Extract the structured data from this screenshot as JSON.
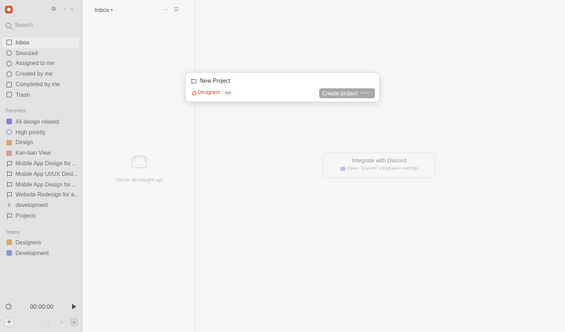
{
  "sidebar": {
    "search_placeholder": "Search",
    "nav": [
      {
        "label": "Inbox",
        "icon": "inbox-icon",
        "active": true
      },
      {
        "label": "Snoozed",
        "icon": "clock-icon"
      },
      {
        "label": "Assigned to me",
        "icon": "target-icon"
      },
      {
        "label": "Created by me",
        "icon": "user-icon"
      },
      {
        "label": "Completed by me",
        "icon": "check-square-icon"
      },
      {
        "label": "Trash",
        "icon": "trash-icon"
      }
    ],
    "favorites_label": "Favorites",
    "favorites": [
      {
        "label": "All design related",
        "icon": "view-icon",
        "color": "#8b7fd6"
      },
      {
        "label": "High priority",
        "icon": "circle-icon",
        "color": "#b18fe3"
      },
      {
        "label": "Design",
        "icon": "grid-icon",
        "color": "#e7b07a"
      },
      {
        "label": "Kan-ban View",
        "icon": "board-icon",
        "color": "#e8a3a3"
      },
      {
        "label": "Mobile App Design for ...",
        "icon": "flag-icon"
      },
      {
        "label": "Mobile App UI/UX Desi...",
        "icon": "flag-icon"
      },
      {
        "label": "Mobile App Design for ...",
        "icon": "flag-icon"
      },
      {
        "label": "Website Redesign for a...",
        "icon": "flag-icon"
      },
      {
        "label": "development",
        "icon": "hash-icon"
      },
      {
        "label": "Projects",
        "icon": "flag-icon"
      }
    ],
    "teams_label": "Teams",
    "teams": [
      {
        "label": "Designers",
        "icon": "team-icon",
        "color": "#e7b07a"
      },
      {
        "label": "Development",
        "icon": "team-icon",
        "color": "#8b9ee6"
      }
    ],
    "timer": "00:00:00"
  },
  "inbox": {
    "title": "Inbox",
    "empty_text": "You're all caught up!"
  },
  "integration": {
    "title": "Integrate with Discord",
    "subtitle": "Open \"Discord\" integration settings"
  },
  "modal": {
    "input_value": "New Project",
    "team": "Designers",
    "tab_hint": "tab",
    "create_label": "Create project",
    "enter_hint": "Enter"
  }
}
